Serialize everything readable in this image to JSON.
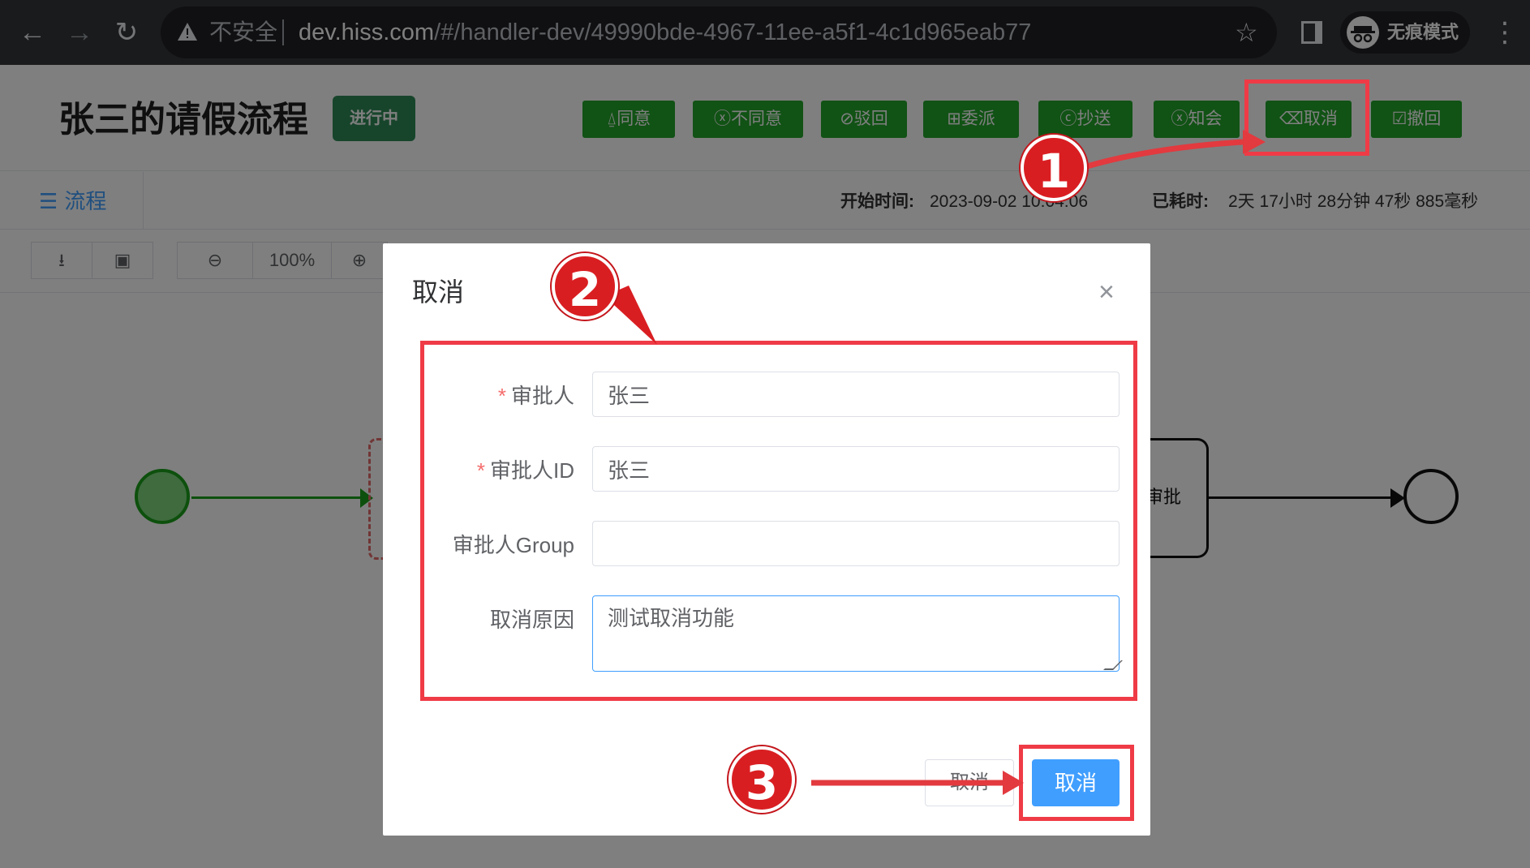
{
  "browser": {
    "insecure_label": "不安全",
    "url_host": "dev.hiss.com",
    "url_path": "/#/handler-dev/49990bde-4967-11ee-a5f1-4c1d965eab77",
    "incognito_label": "无痕模式",
    "back_icon": "←",
    "forward_icon": "→",
    "reload_icon": "↻",
    "star_icon": "☆",
    "menu_icon": "⋮"
  },
  "process": {
    "title": "张三的请假流程",
    "status": "进行中"
  },
  "actions": [
    {
      "icon": "⍙",
      "label": "同意"
    },
    {
      "icon": "ⓧ",
      "label": "不同意"
    },
    {
      "icon": "⊘",
      "label": "驳回"
    },
    {
      "icon": "⊞",
      "label": "委派"
    },
    {
      "icon": "ⓒ",
      "label": "抄送"
    },
    {
      "icon": "ⓧ",
      "label": "知会"
    },
    {
      "icon": "⌫",
      "label": "取消"
    },
    {
      "icon": "☑",
      "label": "撤回"
    }
  ],
  "tab": {
    "icon": "☰",
    "label": "流程"
  },
  "meta": {
    "start_label": "开始时间:",
    "start_value": "2023-09-02 10:04:06",
    "elapsed_label": "已耗时:",
    "elapsed_value": "2天 17小时 28分钟 47秒 885毫秒"
  },
  "toolbar": {
    "download_icon": "⭳",
    "image_icon": "▣",
    "zoom_out_icon": "⊖",
    "zoom_level": "100%",
    "zoom_in_icon": "⊕"
  },
  "diagram": {
    "task2_label": "审批"
  },
  "dialog": {
    "title": "取消",
    "close_icon": "×",
    "fields": {
      "approver": {
        "label": "审批人",
        "value": "张三",
        "required": true
      },
      "approver_id": {
        "label": "审批人ID",
        "value": "张三",
        "required": true
      },
      "approver_group": {
        "label": "审批人Group",
        "value": ""
      },
      "reason": {
        "label": "取消原因",
        "value": "测试取消功能"
      }
    },
    "cancel_button": "取消",
    "confirm_button": "取消"
  },
  "annotations": {
    "step1": "1",
    "step2": "2",
    "step3": "3",
    "highlight_color": "#ef3b46"
  },
  "colors": {
    "action_green": "#22a52b",
    "status_green": "#2e8b57",
    "primary_blue": "#409eff",
    "chrome_dark": "#35363a"
  }
}
